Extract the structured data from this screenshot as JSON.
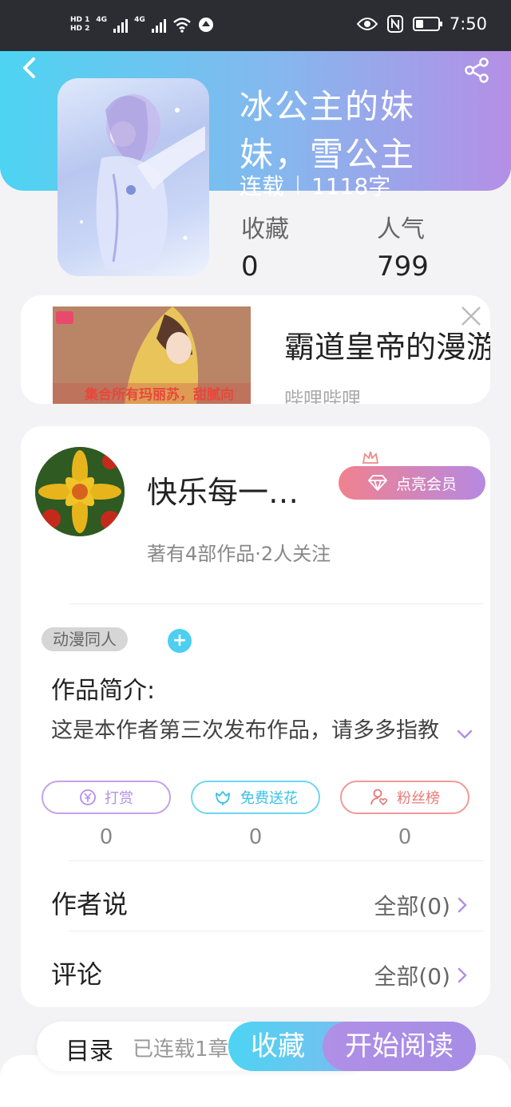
{
  "status_bar": {
    "hd1": "HD 1",
    "hd2": "HD 2",
    "net1": "4G",
    "net2": "4G",
    "time": "7:50"
  },
  "book": {
    "title": "冰公主的妹妹，雪公主",
    "status": "连载",
    "word_count": "1118字",
    "fav_label": "收藏",
    "fav_value": "0",
    "pop_label": "人气",
    "pop_value": "799"
  },
  "ad": {
    "title": "霸道皇帝的漫游",
    "source": "哔哩哔哩",
    "banner_text": "集合所有玛丽苏，甜腻向"
  },
  "author": {
    "name": "快乐每一…",
    "vip_label": "点亮会员",
    "meta": "著有4部作品·2人关注"
  },
  "tags": [
    "动漫同人"
  ],
  "intro": {
    "label": "作品简介:",
    "text": "这是本作者第三次发布作品，请多多指教"
  },
  "support": [
    {
      "label": "打赏",
      "count": "0"
    },
    {
      "label": "免费送花",
      "count": "0"
    },
    {
      "label": "粉丝榜",
      "count": "0"
    }
  ],
  "sections": {
    "author_says": {
      "label": "作者说",
      "link": "全部(0)"
    },
    "comments": {
      "label": "评论",
      "link": "全部(0)"
    }
  },
  "bottom": {
    "toc_label": "目录",
    "toc_status": "已连载1章",
    "fav_button": "收藏",
    "read_button": "开始阅读"
  },
  "colors": {
    "header_start": "#4dd4f2",
    "header_end": "#b48fe6",
    "accent_purple": "#b48fe6",
    "accent_cyan": "#4ccff0",
    "accent_red": "#e87a78"
  }
}
